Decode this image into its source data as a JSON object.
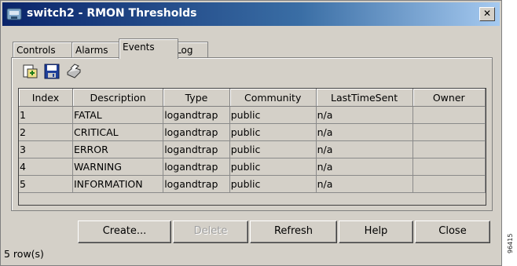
{
  "window": {
    "title": "switch2 - RMON Thresholds",
    "close_glyph": "✕"
  },
  "tabs": [
    {
      "label": "Controls",
      "active": false
    },
    {
      "label": "Alarms",
      "active": false
    },
    {
      "label": "Events",
      "active": true
    },
    {
      "label": "Log",
      "active": false
    }
  ],
  "toolbar": {
    "icons": [
      "insert-row-icon",
      "save-icon",
      "print-icon"
    ]
  },
  "table": {
    "columns": [
      "Index",
      "Description",
      "Type",
      "Community",
      "LastTimeSent",
      "Owner"
    ],
    "rows": [
      [
        "1",
        "FATAL",
        "logandtrap",
        "public",
        "n/a",
        ""
      ],
      [
        "2",
        "CRITICAL",
        "logandtrap",
        "public",
        "n/a",
        ""
      ],
      [
        "3",
        "ERROR",
        "logandtrap",
        "public",
        "n/a",
        ""
      ],
      [
        "4",
        "WARNING",
        "logandtrap",
        "public",
        "n/a",
        ""
      ],
      [
        "5",
        "INFORMATION",
        "logandtrap",
        "public",
        "n/a",
        ""
      ]
    ]
  },
  "buttons": {
    "create": "Create...",
    "delete": "Delete",
    "refresh": "Refresh",
    "help": "Help",
    "close": "Close"
  },
  "status": {
    "row_count": "5 row(s)"
  },
  "side_label": "96415"
}
